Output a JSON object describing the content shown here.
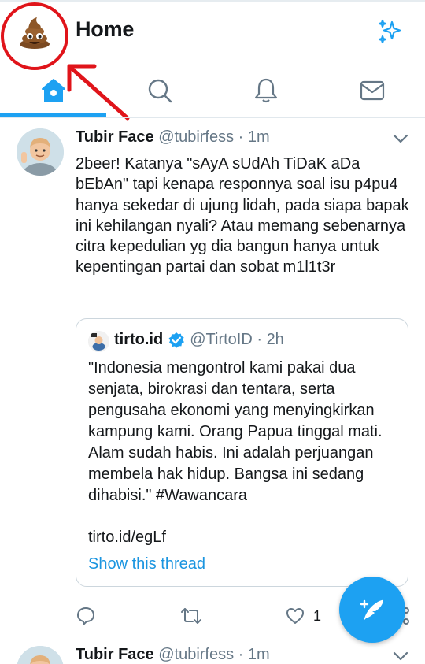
{
  "header": {
    "title": "Home",
    "avatar_icon": "poop-emoji-avatar",
    "sparkle_icon": "sparkle-icon"
  },
  "tabs": [
    {
      "name": "home",
      "icon": "home-icon",
      "active": true
    },
    {
      "name": "search",
      "icon": "search-icon",
      "active": false
    },
    {
      "name": "notifications",
      "icon": "bell-icon",
      "active": false
    },
    {
      "name": "messages",
      "icon": "mail-icon",
      "active": false
    }
  ],
  "tweets": [
    {
      "name": "Tubir Face",
      "handle": "@tubirfess",
      "time": "1m",
      "text": "2beer! Katanya \"sAyA sUdAh TiDaK aDa bEbAn\" tapi kenapa responnya soal isu p4pu4 hanya sekedar di ujung lidah, pada siapa bapak ini kehilangan nyali? Atau memang sebenarnya citra kepedulian yg dia bangun hanya untuk kepentingan partai dan sobat m1l1t3r",
      "quote": {
        "name": "tirto.id",
        "handle": "@TirtoID",
        "time": "2h",
        "text": "\"Indonesia mengontrol kami pakai dua senjata, birokrasi dan tentara, serta pengusaha ekonomi yang menyingkirkan kampung kami. Orang Papua tinggal mati. Alam sudah habis. Ini adalah perjuangan membela hak hidup. Bangsa ini sedang dihabisi.\" #Wawancara",
        "link": "tirto.id/egLf",
        "thread_label": "Show this thread"
      },
      "actions": {
        "like_count": "1"
      }
    },
    {
      "name": "Tubir Face",
      "handle": "@tubirfess",
      "time": "1m"
    }
  ],
  "colors": {
    "accent": "#1da1f2",
    "annotation": "#e0141a"
  }
}
